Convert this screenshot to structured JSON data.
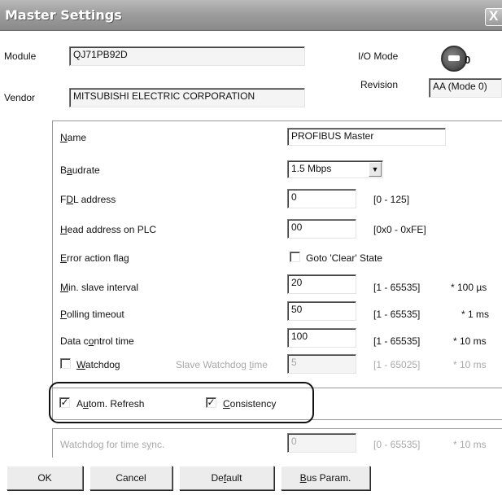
{
  "window": {
    "title": "Master Settings",
    "close_glyph": "X"
  },
  "module": {
    "label": "Module",
    "value": "QJ71PB92D"
  },
  "vendor": {
    "label": "Vendor",
    "value": "MITSUBISHI ELECTRIC CORPORATION"
  },
  "io_mode": {
    "label": "I/O Mode",
    "value": "0"
  },
  "revision": {
    "label": "Revision",
    "value": "AA (Mode 0)"
  },
  "params": {
    "name": {
      "label_pre": "",
      "label_ul": "N",
      "label_post": "ame",
      "value": "PROFIBUS Master"
    },
    "baudrate": {
      "label_pre": "B",
      "label_ul": "a",
      "label_post": "udrate",
      "value": "1.5 Mbps"
    },
    "fdl": {
      "label_pre": "F",
      "label_ul": "D",
      "label_post": "L address",
      "value": "0",
      "range": "[0 - 125]"
    },
    "head": {
      "label_pre": "",
      "label_ul": "H",
      "label_post": "ead address on PLC",
      "value": "00",
      "range": "[0x0 - 0xFE]"
    },
    "error": {
      "label_pre": "",
      "label_ul": "E",
      "label_post": "rror action flag",
      "checkbox_label": "Goto 'Clear' State"
    },
    "min_slave": {
      "label_pre": "",
      "label_ul": "M",
      "label_post": "in. slave interval",
      "value": "20",
      "range": "[1 - 65535]",
      "unit": "* 100 µs"
    },
    "polling": {
      "label_pre": "",
      "label_ul": "P",
      "label_post": "olling timeout",
      "value": "50",
      "range": "[1 - 65535]",
      "unit": "* 1 ms"
    },
    "data_control": {
      "label_pre": "Data c",
      "label_ul": "o",
      "label_post": "ntrol time",
      "value": "100",
      "range": "[1 - 65535]",
      "unit": "* 10 ms"
    },
    "watchdog": {
      "label_pre": "",
      "label_ul": "W",
      "label_post": "atchdog",
      "slave_label_pre": "Slave Watchdog ",
      "slave_label_ul": "t",
      "slave_label_post": "ime",
      "value": "5",
      "range": "[1 - 65025]",
      "unit": "* 10 ms"
    }
  },
  "options": {
    "autom_refresh": {
      "label_pre": "A",
      "label_ul": "u",
      "label_post": "tom. Refresh",
      "checked_glyph": "✓"
    },
    "consistency": {
      "label_pre": "",
      "label_ul": "C",
      "label_post": "onsistency",
      "checked_glyph": "✓"
    }
  },
  "time_sync": {
    "label_pre": "Watchdog for time s",
    "label_ul": "y",
    "label_post": "nc.",
    "value": "0",
    "range": "[0 - 65535]",
    "unit": "* 10 ms"
  },
  "buttons": {
    "ok": "OK",
    "cancel": "Cancel",
    "default_pre": "De",
    "default_ul": "f",
    "default_post": "ault",
    "bus_pre": "",
    "bus_ul": "B",
    "bus_post": "us Param."
  }
}
